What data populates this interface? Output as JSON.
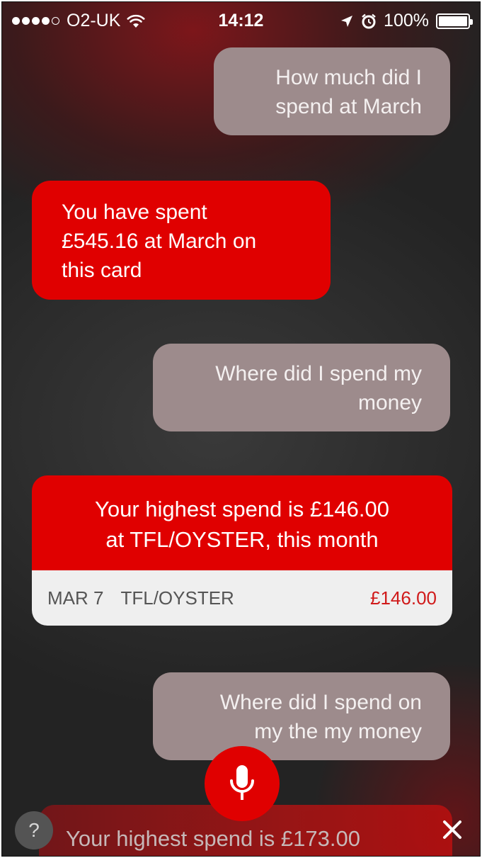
{
  "status_bar": {
    "carrier": "O2-UK",
    "time": "14:12",
    "battery": "100%"
  },
  "messages": [
    {
      "role": "user",
      "text": "How much did I\nspend at March"
    },
    {
      "role": "bot",
      "text": "You have spent\n£545.16 at March on\nthis card"
    },
    {
      "role": "user",
      "text": "Where did I spend my\nmoney"
    },
    {
      "role": "bot_card",
      "text": "Your highest spend is £146.00\nat TFL/OYSTER, this month",
      "transaction": {
        "date": "MAR 7",
        "merchant": "TFL/OYSTER",
        "amount": "£146.00"
      }
    },
    {
      "role": "user",
      "text": "Where did I spend on\nmy the my money"
    },
    {
      "role": "bot_partial",
      "text": "Your highest spend is £173.00"
    }
  ],
  "controls": {
    "help_label": "?",
    "mic_icon": "microphone-icon",
    "close_icon": "close-icon"
  },
  "colors": {
    "brand_red": "#e00000",
    "user_bubble": "#9d8b8c",
    "amount_red": "#d01a1a"
  }
}
